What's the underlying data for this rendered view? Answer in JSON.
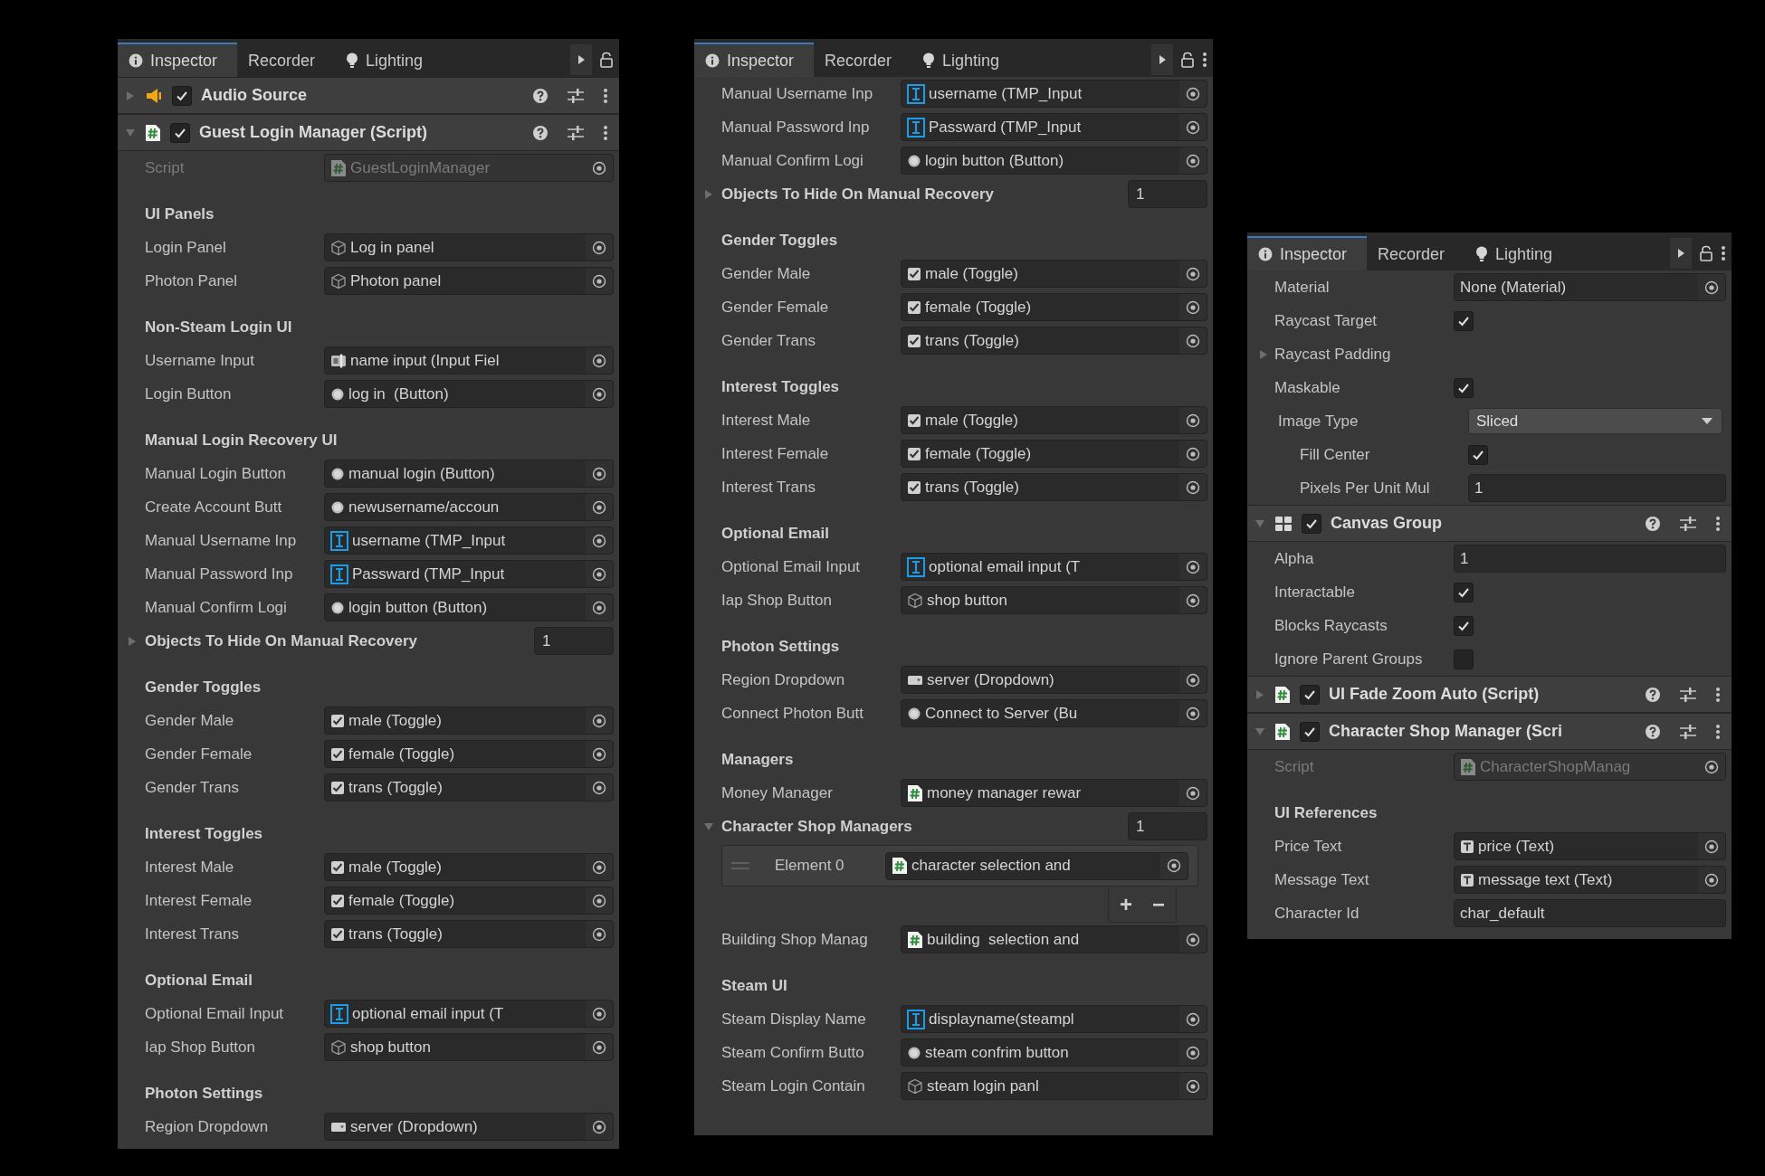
{
  "panels": [
    {
      "tabs": [
        {
          "label": "Inspector",
          "selected": true
        },
        {
          "label": "Recorder",
          "selected": false
        },
        {
          "label": "Lighting",
          "selected": false
        }
      ],
      "rows": [
        {
          "kind": "audio_component",
          "title": "Audio Source",
          "expanded": false,
          "enabled": true
        },
        {
          "kind": "script_component",
          "title": "Guest Login Manager (Script)",
          "expanded": true,
          "enabled": true
        },
        {
          "kind": "script_ref",
          "label": "Script",
          "value": "GuestLoginManager",
          "disabled": true
        },
        {
          "kind": "header",
          "label": "UI Panels"
        },
        {
          "kind": "gameobject_ref",
          "label": "Login Panel",
          "value": "Log in panel",
          "disabled": false
        },
        {
          "kind": "gameobject_ref",
          "label": "Photon Panel",
          "value": "Photon panel",
          "disabled": false
        },
        {
          "kind": "header",
          "label": "Non-Steam Login UI"
        },
        {
          "kind": "inputfield_ref",
          "label": "Username Input",
          "value": "name input (Input Fiel",
          "disabled": false
        },
        {
          "kind": "button_ref",
          "label": "Login Button",
          "value": "log in  (Button)",
          "disabled": false
        },
        {
          "kind": "header",
          "label": "Manual Login Recovery UI"
        },
        {
          "kind": "button_ref",
          "label": "Manual Login Button",
          "value": "manual login (Button)",
          "disabled": false
        },
        {
          "kind": "button_ref",
          "label": "Create Account Butt",
          "value": "newusername/accoun",
          "disabled": false
        },
        {
          "kind": "tmp_ref",
          "label": "Manual Username Inp",
          "value": "username (TMP_Input",
          "disabled": false
        },
        {
          "kind": "tmp_ref",
          "label": "Manual Password Inp",
          "value": "Passward (TMP_Input",
          "disabled": false
        },
        {
          "kind": "button_ref",
          "label": "Manual Confirm Logi",
          "value": "login button (Button)",
          "disabled": false
        },
        {
          "kind": "array",
          "label": "Objects To Hide On Manual Recovery",
          "expanded": false,
          "count": "1"
        },
        {
          "kind": "header",
          "label": "Gender Toggles"
        },
        {
          "kind": "toggle_ref",
          "label": "Gender Male",
          "value": "male (Toggle)",
          "disabled": false
        },
        {
          "kind": "toggle_ref",
          "label": "Gender Female",
          "value": "female (Toggle)",
          "disabled": false
        },
        {
          "kind": "toggle_ref",
          "label": "Gender Trans",
          "value": "trans (Toggle)",
          "disabled": false
        },
        {
          "kind": "header",
          "label": "Interest Toggles"
        },
        {
          "kind": "toggle_ref",
          "label": "Interest Male",
          "value": "male (Toggle)",
          "disabled": false
        },
        {
          "kind": "toggle_ref",
          "label": "Interest Female",
          "value": "female (Toggle)",
          "disabled": false
        },
        {
          "kind": "toggle_ref",
          "label": "Interest Trans",
          "value": "trans (Toggle)",
          "disabled": false
        },
        {
          "kind": "header",
          "label": "Optional Email"
        },
        {
          "kind": "tmp_ref",
          "label": "Optional Email Input",
          "value": "optional email input (T",
          "disabled": false
        },
        {
          "kind": "gameobject_ref",
          "label": "Iap Shop Button",
          "value": "shop button",
          "disabled": false
        },
        {
          "kind": "header",
          "label": "Photon Settings"
        },
        {
          "kind": "dropdown_ref",
          "label": "Region Dropdown",
          "value": "server (Dropdown)",
          "disabled": false
        }
      ]
    },
    {
      "tabs": [
        {
          "label": "Inspector",
          "selected": true
        },
        {
          "label": "Recorder",
          "selected": false
        },
        {
          "label": "Lighting",
          "selected": false
        }
      ],
      "rows": [
        {
          "kind": "tmp_ref",
          "label": "Manual Username Inp",
          "value": "username (TMP_Input",
          "disabled": false
        },
        {
          "kind": "tmp_ref",
          "label": "Manual Password Inp",
          "value": "Passward (TMP_Input",
          "disabled": false
        },
        {
          "kind": "button_ref",
          "label": "Manual Confirm Logi",
          "value": "login button (Button)",
          "disabled": false
        },
        {
          "kind": "array",
          "label": "Objects To Hide On Manual Recovery",
          "expanded": false,
          "count": "1"
        },
        {
          "kind": "header",
          "label": "Gender Toggles"
        },
        {
          "kind": "toggle_ref",
          "label": "Gender Male",
          "value": "male (Toggle)",
          "disabled": false
        },
        {
          "kind": "toggle_ref",
          "label": "Gender Female",
          "value": "female (Toggle)",
          "disabled": false
        },
        {
          "kind": "toggle_ref",
          "label": "Gender Trans",
          "value": "trans (Toggle)",
          "disabled": false
        },
        {
          "kind": "header",
          "label": "Interest Toggles"
        },
        {
          "kind": "toggle_ref",
          "label": "Interest Male",
          "value": "male (Toggle)",
          "disabled": false
        },
        {
          "kind": "toggle_ref",
          "label": "Interest Female",
          "value": "female (Toggle)",
          "disabled": false
        },
        {
          "kind": "toggle_ref",
          "label": "Interest Trans",
          "value": "trans (Toggle)",
          "disabled": false
        },
        {
          "kind": "header",
          "label": "Optional Email"
        },
        {
          "kind": "tmp_ref",
          "label": "Optional Email Input",
          "value": "optional email input (T",
          "disabled": false
        },
        {
          "kind": "gameobject_ref",
          "label": "Iap Shop Button",
          "value": "shop button",
          "disabled": false
        },
        {
          "kind": "header",
          "label": "Photon Settings"
        },
        {
          "kind": "dropdown_ref",
          "label": "Region Dropdown",
          "value": "server (Dropdown)",
          "disabled": false
        },
        {
          "kind": "button_ref",
          "label": "Connect Photon Butt",
          "value": "Connect to Server (Bu",
          "disabled": false
        },
        {
          "kind": "header",
          "label": "Managers"
        },
        {
          "kind": "script_ref",
          "label": "Money Manager",
          "value": "money manager rewar",
          "disabled": false
        },
        {
          "kind": "array",
          "label": "Character Shop Managers",
          "expanded": true,
          "count": "1"
        },
        {
          "kind": "script_element",
          "label": "Element 0",
          "value": "character selection and"
        },
        {
          "kind": "addremove",
          "add": "+",
          "remove": "−"
        },
        {
          "kind": "script_ref",
          "label": "Building Shop Manag",
          "value": "building  selection and",
          "disabled": false
        },
        {
          "kind": "header",
          "label": "Steam UI"
        },
        {
          "kind": "tmp_ref",
          "label": "Steam Display Name",
          "value": "displayname(steampl",
          "disabled": false
        },
        {
          "kind": "button_ref",
          "label": "Steam Confirm Butto",
          "value": "steam confrim button",
          "disabled": false
        },
        {
          "kind": "gameobject_ref",
          "label": "Steam Login Contain",
          "value": "steam login panl",
          "disabled": false
        }
      ]
    },
    {
      "tabs": [
        {
          "label": "Inspector",
          "selected": true
        },
        {
          "label": "Recorder",
          "selected": false
        },
        {
          "label": "Lighting",
          "selected": false
        }
      ],
      "rows": [
        {
          "kind": "plain_ref",
          "label": "Material",
          "value": "None (Material)",
          "disabled": false
        },
        {
          "kind": "checkbox",
          "label": "Raycast Target",
          "checked": true
        },
        {
          "kind": "foldout",
          "label": "Raycast Padding",
          "expanded": false
        },
        {
          "kind": "checkbox",
          "label": "Maskable",
          "checked": true
        },
        {
          "kind": "dropdown",
          "label": "Image Type",
          "value": "Sliced",
          "children": [
            {
              "kind": "checkbox",
              "label": "Fill Center",
              "checked": true
            },
            {
              "kind": "text",
              "label": "Pixels Per Unit Mul",
              "value": "1"
            }
          ]
        },
        {
          "kind": "canvasgroup_component",
          "title": "Canvas Group",
          "expanded": true,
          "enabled": true
        },
        {
          "kind": "text",
          "label": "Alpha",
          "value": "1"
        },
        {
          "kind": "checkbox",
          "label": "Interactable",
          "checked": true
        },
        {
          "kind": "checkbox",
          "label": "Blocks Raycasts",
          "checked": true
        },
        {
          "kind": "checkbox",
          "label": "Ignore Parent Groups",
          "checked": false
        },
        {
          "kind": "script_component",
          "title": "UI Fade Zoom Auto (Script)",
          "expanded": false,
          "enabled": true
        },
        {
          "kind": "script_component",
          "title": "Character Shop Manager (Scri",
          "expanded": true,
          "enabled": true
        },
        {
          "kind": "script_ref",
          "label": "Script",
          "value": "CharacterShopManag",
          "disabled": true
        },
        {
          "kind": "header",
          "label": "UI References"
        },
        {
          "kind": "text_ref",
          "label": "Price Text",
          "value": "price (Text)",
          "disabled": false
        },
        {
          "kind": "text_ref",
          "label": "Message Text",
          "value": "message text (Text)",
          "disabled": false
        },
        {
          "kind": "text",
          "label": "Character Id",
          "value": "char_default"
        }
      ]
    }
  ]
}
